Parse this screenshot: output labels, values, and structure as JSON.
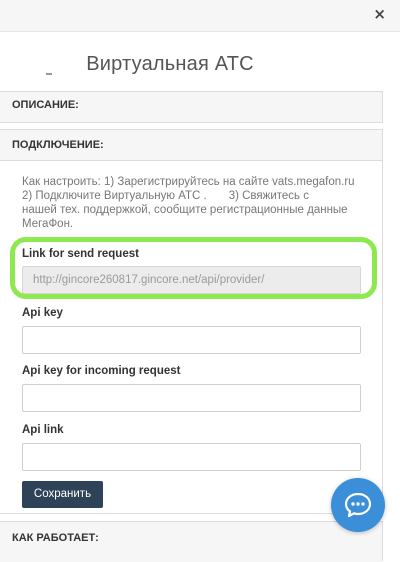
{
  "header": {
    "close_symbol": "×",
    "title": "Виртуальная АТС"
  },
  "panels": {
    "description": {
      "label": "ОПИСАНИЕ:"
    },
    "connection": {
      "label": "ПОДКЛЮЧЕНИЕ:",
      "intro_line1": "Как настроить: 1) Зарегистрируйтесь на сайте vats.megafon.ru",
      "intro_line2a": "2) Подключите Виртуальную АТС .",
      "intro_line2b": "3) Свяжитесь с",
      "intro_line3": "нашей тех. поддержкой, сообщите регистрационные данные",
      "intro_line4": "МегаФон."
    },
    "how_it_works": {
      "label": "КАК РАБОТАЕТ:"
    }
  },
  "form": {
    "link_label": "Link for send request",
    "link_value": "http://gincore260817.gincore.net/api/provider/",
    "api_key_label": "Api key",
    "api_key_value": "",
    "api_key_incoming_label": "Api key for incoming request",
    "api_key_incoming_value": "",
    "api_link_label": "Api link",
    "api_link_value": "",
    "save_label": "Сохранить"
  },
  "colors": {
    "highlight": "#8ee84f",
    "save_button": "#2e4258",
    "chat_button": "#3a8fd8"
  },
  "icons": {
    "close": "close-icon",
    "chat": "chat-icon"
  }
}
